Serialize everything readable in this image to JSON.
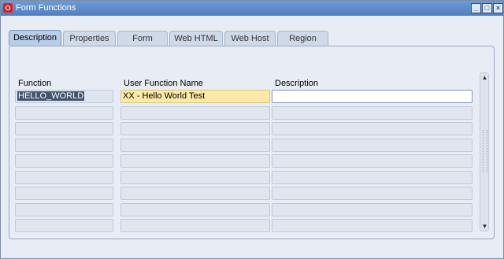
{
  "window": {
    "title": "Form Functions",
    "buttons": [
      "_",
      "□",
      "×"
    ]
  },
  "tabs": [
    "Description",
    "Properties",
    "Form",
    "Web HTML",
    "Web Host",
    "Region"
  ],
  "active_tab": "Description",
  "columns": {
    "function": "Function",
    "user_function_name": "User Function Name",
    "description": "Description"
  },
  "rows": [
    {
      "function": "HELLO_WORLD",
      "user_function_name": "XX - Hello World Test",
      "description": ""
    },
    {
      "function": "",
      "user_function_name": "",
      "description": ""
    },
    {
      "function": "",
      "user_function_name": "",
      "description": ""
    },
    {
      "function": "",
      "user_function_name": "",
      "description": ""
    },
    {
      "function": "",
      "user_function_name": "",
      "description": ""
    },
    {
      "function": "",
      "user_function_name": "",
      "description": ""
    },
    {
      "function": "",
      "user_function_name": "",
      "description": ""
    },
    {
      "function": "",
      "user_function_name": "",
      "description": ""
    },
    {
      "function": "",
      "user_function_name": "",
      "description": ""
    }
  ],
  "icons": {
    "app": "oracle-app-icon",
    "scroll_up": "scroll-up-arrow-icon",
    "scroll_down": "scroll-down-arrow-icon"
  }
}
